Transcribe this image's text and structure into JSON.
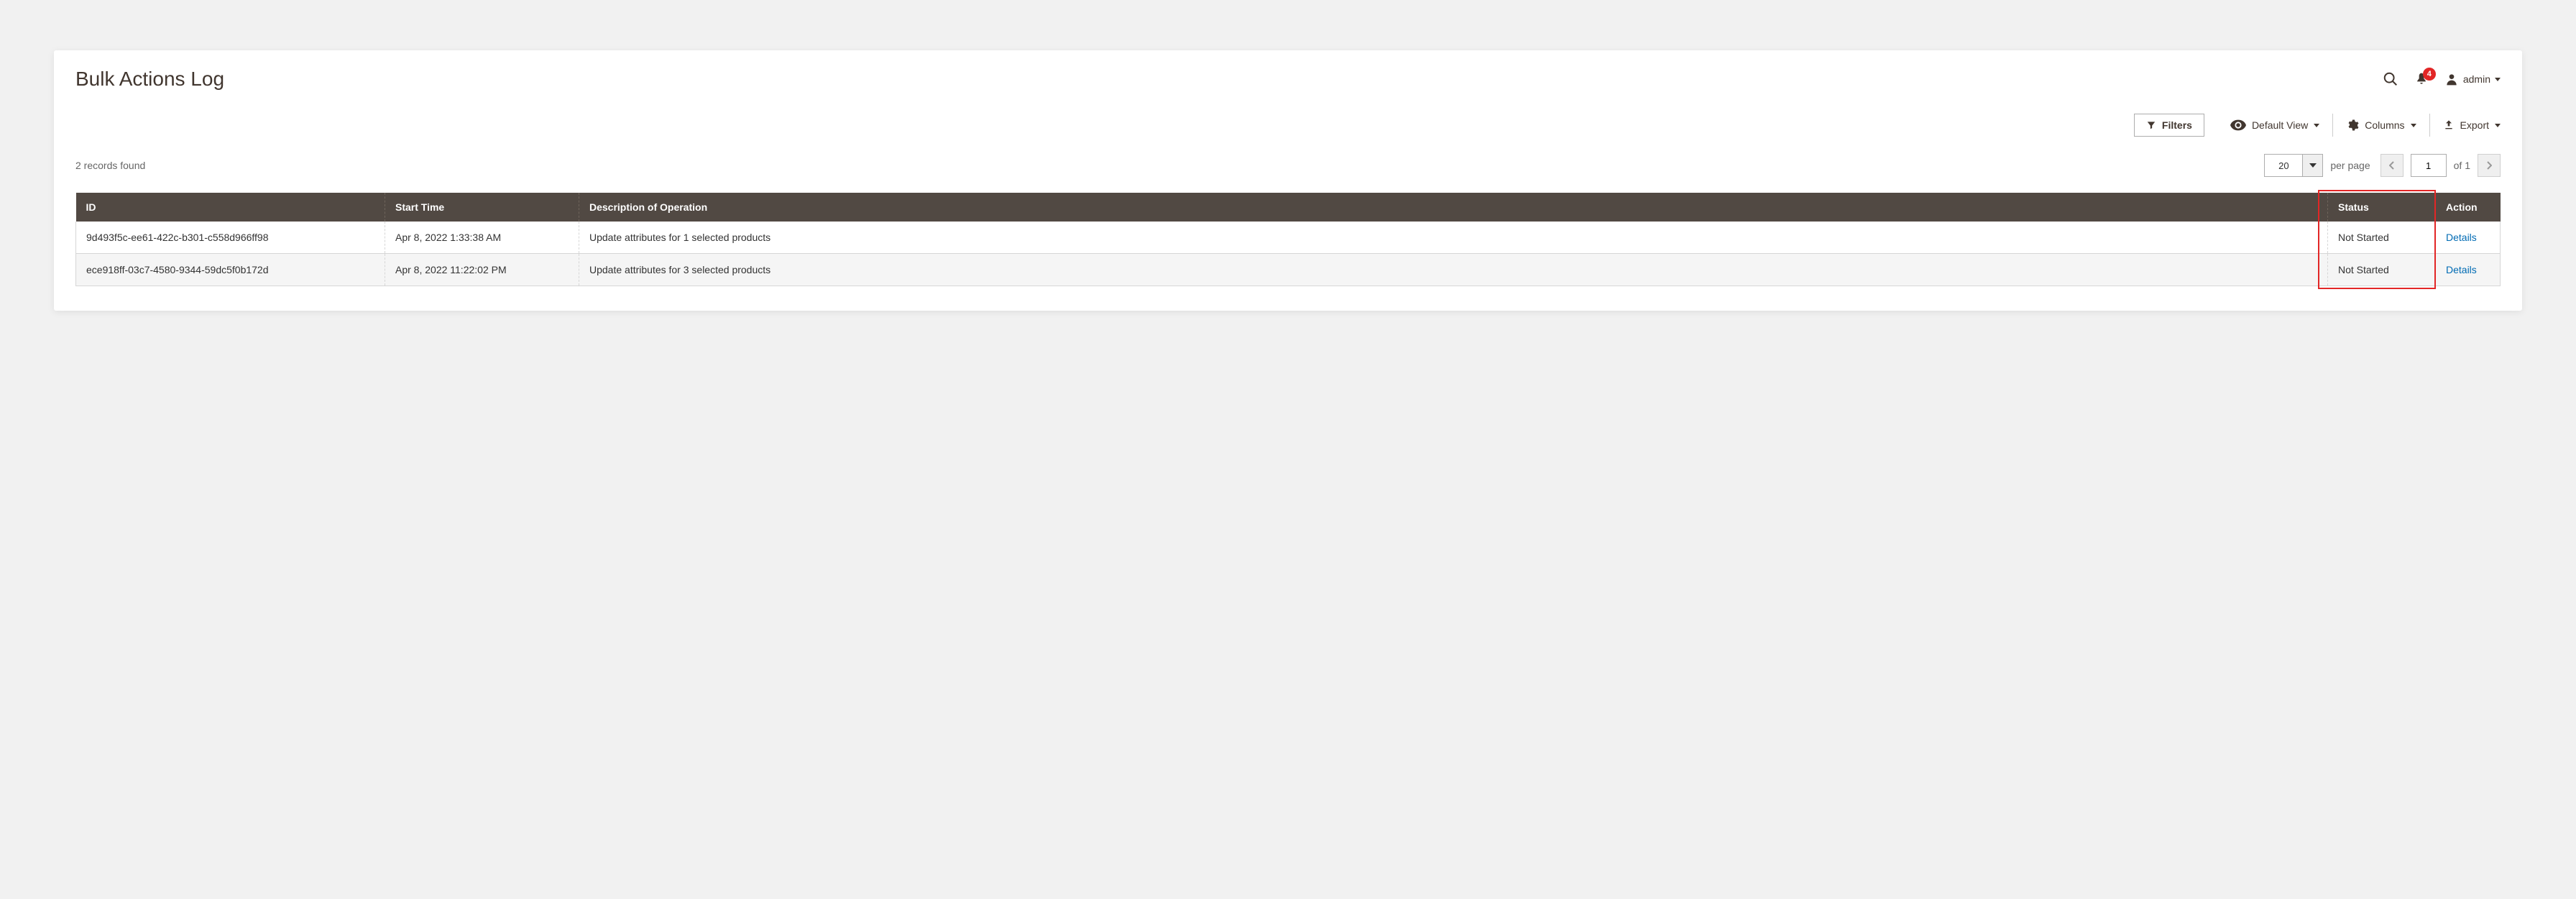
{
  "header": {
    "title": "Bulk Actions Log",
    "notif_count": "4",
    "user_name": "admin"
  },
  "toolbar": {
    "filters_label": "Filters",
    "default_view_label": "Default View",
    "columns_label": "Columns",
    "export_label": "Export"
  },
  "list": {
    "records_found": "2 records found",
    "per_page_value": "20",
    "per_page_label": "per page",
    "page_current": "1",
    "page_of_label": "of",
    "page_total": "1"
  },
  "table": {
    "headers": {
      "id": "ID",
      "start_time": "Start Time",
      "description": "Description of Operation",
      "status": "Status",
      "action": "Action"
    },
    "rows": [
      {
        "id": "9d493f5c-ee61-422c-b301-c558d966ff98",
        "start_time": "Apr 8, 2022 1:33:38 AM",
        "description": "Update attributes for 1 selected products",
        "status": "Not Started",
        "action": "Details"
      },
      {
        "id": "ece918ff-03c7-4580-9344-59dc5f0b172d",
        "start_time": "Apr 8, 2022 11:22:02 PM",
        "description": "Update attributes for 3 selected products",
        "status": "Not Started",
        "action": "Details"
      }
    ]
  }
}
